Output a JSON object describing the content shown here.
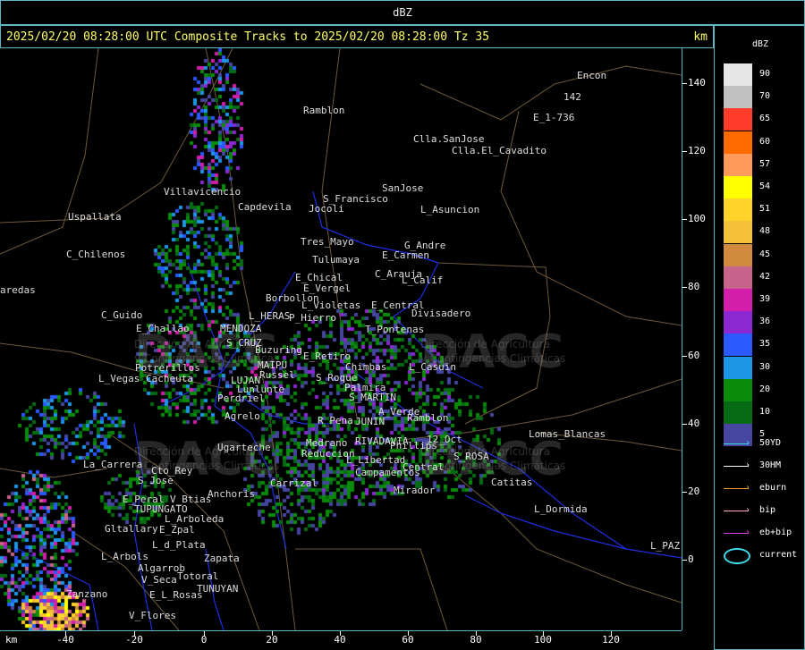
{
  "title": "dBZ",
  "header": {
    "text": "2025/02/20 08:28:00 UTC Composite Tracks to 2025/02/20 08:28:00 Tz 35",
    "unit": "km"
  },
  "xaxis": {
    "unit": "km",
    "ticks": [
      "-40",
      "-20",
      "0",
      "20",
      "40",
      "60",
      "80",
      "100",
      "120"
    ]
  },
  "yaxis": {
    "ticks": [
      "140",
      "120",
      "100",
      "80",
      "60",
      "40",
      "20",
      "0"
    ]
  },
  "legend": {
    "title": "dBZ",
    "levels": [
      {
        "label": "90",
        "color": "#e6e6e6"
      },
      {
        "label": "70",
        "color": "#c0c0c0"
      },
      {
        "label": "65",
        "color": "#ff3b2a"
      },
      {
        "label": "60",
        "color": "#ff6a00"
      },
      {
        "label": "57",
        "color": "#ff9a5a"
      },
      {
        "label": "54",
        "color": "#ffff00"
      },
      {
        "label": "51",
        "color": "#ffd42a"
      },
      {
        "label": "48",
        "color": "#f5c03a"
      },
      {
        "label": "45",
        "color": "#d28a3e"
      },
      {
        "label": "42",
        "color": "#c8648c"
      },
      {
        "label": "39",
        "color": "#d21eaa"
      },
      {
        "label": "36",
        "color": "#8c28d2"
      },
      {
        "label": "35",
        "color": "#2a5aff"
      },
      {
        "label": "30",
        "color": "#1e96e6"
      },
      {
        "label": "20",
        "color": "#0a8c0a"
      },
      {
        "label": "10",
        "color": "#076a14"
      },
      {
        "label": "5",
        "color": "#4646a0"
      }
    ],
    "tracks": [
      {
        "label": "50YD",
        "color": "#40d8e8"
      },
      {
        "label": "30HM",
        "color": "#ffffff"
      },
      {
        "label": "eburn",
        "color": "#f0a030"
      },
      {
        "label": "bip",
        "color": "#ffb0c8"
      },
      {
        "label": "eb+bip",
        "color": "#e040e0"
      },
      {
        "label": "current",
        "color": "#40d8e8"
      }
    ]
  },
  "watermark": {
    "brand": "DACC",
    "line1": "Dirección de Agricultura",
    "line2": "y Contingencias Climáticas"
  },
  "places": [
    {
      "name": "Encon"
    },
    {
      "name": "142"
    },
    {
      "name": "E_1-736"
    },
    {
      "name": "Ramblon"
    },
    {
      "name": "Clla.SanJose"
    },
    {
      "name": "Clla.El_Cavadito"
    },
    {
      "name": "SanJose"
    },
    {
      "name": "S_Francisco"
    },
    {
      "name": "Jocoli"
    },
    {
      "name": "L_Asuncion"
    },
    {
      "name": "Villavicencio"
    },
    {
      "name": "Capdevila"
    },
    {
      "name": "Uspallata"
    },
    {
      "name": "Tres_Mayo"
    },
    {
      "name": "G_Andre"
    },
    {
      "name": "E_Carmen"
    },
    {
      "name": "Tulumaya"
    },
    {
      "name": "C_Chilenos"
    },
    {
      "name": "E_Chical"
    },
    {
      "name": "C_Arauja"
    },
    {
      "name": "L_Calif"
    },
    {
      "name": "E_Vergel"
    },
    {
      "name": "Borbollon"
    },
    {
      "name": "L_Violetas"
    },
    {
      "name": "E_Central"
    },
    {
      "name": "Divisadero"
    },
    {
      "name": "aredas"
    },
    {
      "name": "C_Guido"
    },
    {
      "name": "L_HERAS"
    },
    {
      "name": "P_Hierro"
    },
    {
      "name": "MENDOZA"
    },
    {
      "name": "T_Pontenas"
    },
    {
      "name": "E_Challao"
    },
    {
      "name": "S_CRUZ"
    },
    {
      "name": "Buzuring"
    },
    {
      "name": "E_Retiro"
    },
    {
      "name": "Chimbas"
    },
    {
      "name": "L_Casuin"
    },
    {
      "name": "Potrerillos"
    },
    {
      "name": "MAIPU"
    },
    {
      "name": "L_Vegas"
    },
    {
      "name": "Cacheuta"
    },
    {
      "name": "Russel"
    },
    {
      "name": "S_Roque"
    },
    {
      "name": "LUJAN"
    },
    {
      "name": "Lunlunte"
    },
    {
      "name": "Palmira"
    },
    {
      "name": "S_MARTIN"
    },
    {
      "name": "Perdriel"
    },
    {
      "name": "A_Verde"
    },
    {
      "name": "Ramblon"
    },
    {
      "name": "Agrelo"
    },
    {
      "name": "R_Pena"
    },
    {
      "name": "JUNIN"
    },
    {
      "name": "Medrano"
    },
    {
      "name": "RIVADAVIA"
    },
    {
      "name": "Phillips"
    },
    {
      "name": "12_Oct"
    },
    {
      "name": "Lomas_Blancas"
    },
    {
      "name": "Ugarteche"
    },
    {
      "name": "Reduccion"
    },
    {
      "name": "L_Libertad"
    },
    {
      "name": "S_ROSA"
    },
    {
      "name": "La_Carrera"
    },
    {
      "name": "Cto_Rey"
    },
    {
      "name": "Campamentos"
    },
    {
      "name": "Central"
    },
    {
      "name": "S_Jose"
    },
    {
      "name": "Carrizal"
    },
    {
      "name": "Catitas"
    },
    {
      "name": "Anchoris"
    },
    {
      "name": "Mirador"
    },
    {
      "name": "E_Peral"
    },
    {
      "name": "V_Btias"
    },
    {
      "name": "TUPUNGATO"
    },
    {
      "name": "L_Dormida"
    },
    {
      "name": "L_Arboleda"
    },
    {
      "name": "Gltallary"
    },
    {
      "name": "E_Zpal"
    },
    {
      "name": "L_d_Plata"
    },
    {
      "name": "L_PAZ"
    },
    {
      "name": "L_Arbols"
    },
    {
      "name": "Zapata"
    },
    {
      "name": "Algarrob"
    },
    {
      "name": "V_Seca"
    },
    {
      "name": "Totoral"
    },
    {
      "name": "Zanzano"
    },
    {
      "name": "E_L_Rosas"
    },
    {
      "name": "TUNUYAN"
    },
    {
      "name": "V_Flores"
    }
  ]
}
